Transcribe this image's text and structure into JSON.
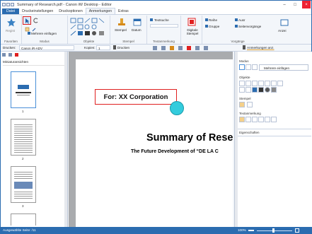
{
  "window": {
    "title": "Summary of Research.pdf - Canon iW Desktop - Editor"
  },
  "tabs": [
    "Datei",
    "Druckeinstellungen",
    "Druckoptionen",
    "Anmerkungen",
    "Extras"
  ],
  "ribbon": {
    "groups": {
      "favorites": "Favoriten",
      "mode": "Modus",
      "objects": "Objekte",
      "stamp": "Stempel",
      "text_annotation": "Textanmerkung",
      "processes": "Vorgänge"
    },
    "register_label": "Regist",
    "insert_multiple": "Mehrere einfügen",
    "stamp_label": "Stempel",
    "date_label": "Datum",
    "textsuche": "Textsuche",
    "digital_stamp": "Digitale Stempel",
    "reihe": "Reihe",
    "gruppe": "Gruppe",
    "ausr": "Ausr",
    "seitenvorgange": "Seitenvorgänge",
    "anzeigen": "Anzei"
  },
  "toolbar2": {
    "printer_label": "Drucken:",
    "printer_value": "Canon iR-ADV",
    "copies_label": "Kopien:",
    "copies_value": "1",
    "print_button": "Drucken",
    "annotations_button": "Anmerkungen anz."
  },
  "left_panel": {
    "title": "Miniaturansichten",
    "page_numbers": [
      "1",
      "2",
      "3"
    ]
  },
  "document": {
    "annotation_text": "For: XX Corporation",
    "heading": "Summary of Rese",
    "subheading": "The Future Development of “DE LA C"
  },
  "right_panel": {
    "sections": {
      "mode": "Modus",
      "objects": "Objekte",
      "stamp": "Stempel",
      "text_annotation": "Textanmerkung",
      "properties": "Eigenschaften"
    },
    "insert_multiple": "Mehrere einfügen"
  },
  "status": {
    "left": "Ausgewählte Seite: /11",
    "zoom": "100%"
  },
  "colors": {
    "accent": "#2b6cb0",
    "annotation_red": "#e02020",
    "cyan": "#33ccdd"
  }
}
